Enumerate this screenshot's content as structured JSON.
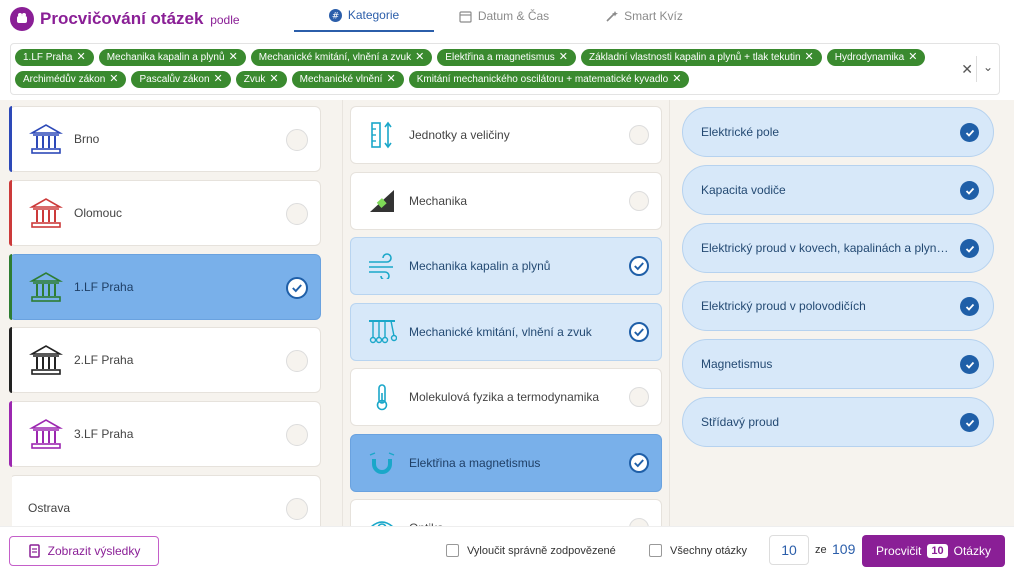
{
  "app": {
    "title": "Procvičování otázek",
    "title_suffix": "podle",
    "accent": "#8a1f96"
  },
  "tabs": [
    {
      "label": "Kategorie",
      "icon": "hash-icon",
      "active": true
    },
    {
      "label": "Datum & Čas",
      "icon": "calendar-icon",
      "active": false
    },
    {
      "label": "Smart Kvíz",
      "icon": "magic-icon",
      "active": false
    }
  ],
  "chips": [
    "1.LF Praha",
    "Mechanika kapalin a plynů",
    "Mechanické kmitání, vlnění a zvuk",
    "Elektřina a magnetismus",
    "Základní vlastnosti kapalin a plynů + tlak tekutin",
    "Hydrodynamika",
    "Archimédův zákon",
    "Pascalův zákon",
    "Zvuk",
    "Mechanické vlnění",
    "Kmitání mechanického oscilátoru + matematické kyvadlo"
  ],
  "chip_color": "#3a8a2f",
  "universities": [
    {
      "label": "Brno",
      "color": "#2d49b8",
      "selected": false
    },
    {
      "label": "Olomouc",
      "color": "#cc3a3a",
      "selected": false
    },
    {
      "label": "1.LF Praha",
      "color": "#2e7d32",
      "selected": true
    },
    {
      "label": "2.LF Praha",
      "color": "#222222",
      "selected": false
    },
    {
      "label": "3.LF Praha",
      "color": "#9c27b0",
      "selected": false
    },
    {
      "label": "Ostrava",
      "color": "#f6f3ee",
      "selected": false
    }
  ],
  "categories": [
    {
      "label": "Jednotky a veličiny",
      "icon": "ruler-icon",
      "state": "none"
    },
    {
      "label": "Mechanika",
      "icon": "incline-icon",
      "state": "none"
    },
    {
      "label": "Mechanika kapalin a plynů",
      "icon": "wind-icon",
      "state": "selected"
    },
    {
      "label": "Mechanické kmitání, vlnění a zvuk",
      "icon": "pendulum-icon",
      "state": "selected"
    },
    {
      "label": "Molekulová fyzika a termodynamika",
      "icon": "thermometer-icon",
      "state": "none"
    },
    {
      "label": "Elektřina a magnetismus",
      "icon": "magnet-icon",
      "state": "strong"
    },
    {
      "label": "Optika",
      "icon": "eye-icon",
      "state": "none"
    }
  ],
  "topics": [
    "Elektrické pole",
    "Kapacita vodiče",
    "Elektrický proud v kovech, kapalinách a plynech",
    "Elektrický proud v polovodičích",
    "Magnetismus",
    "Střídavý proud"
  ],
  "footer": {
    "results_label": "Zobrazit výsledky",
    "exclude_label": "Vyloučit správně zodpovězené",
    "all_label": "Všechny otázky",
    "count": "10",
    "ze_label": "ze",
    "total": "109",
    "go_label": "Procvičit",
    "go_count": "10",
    "go_suffix": "Otázky"
  }
}
